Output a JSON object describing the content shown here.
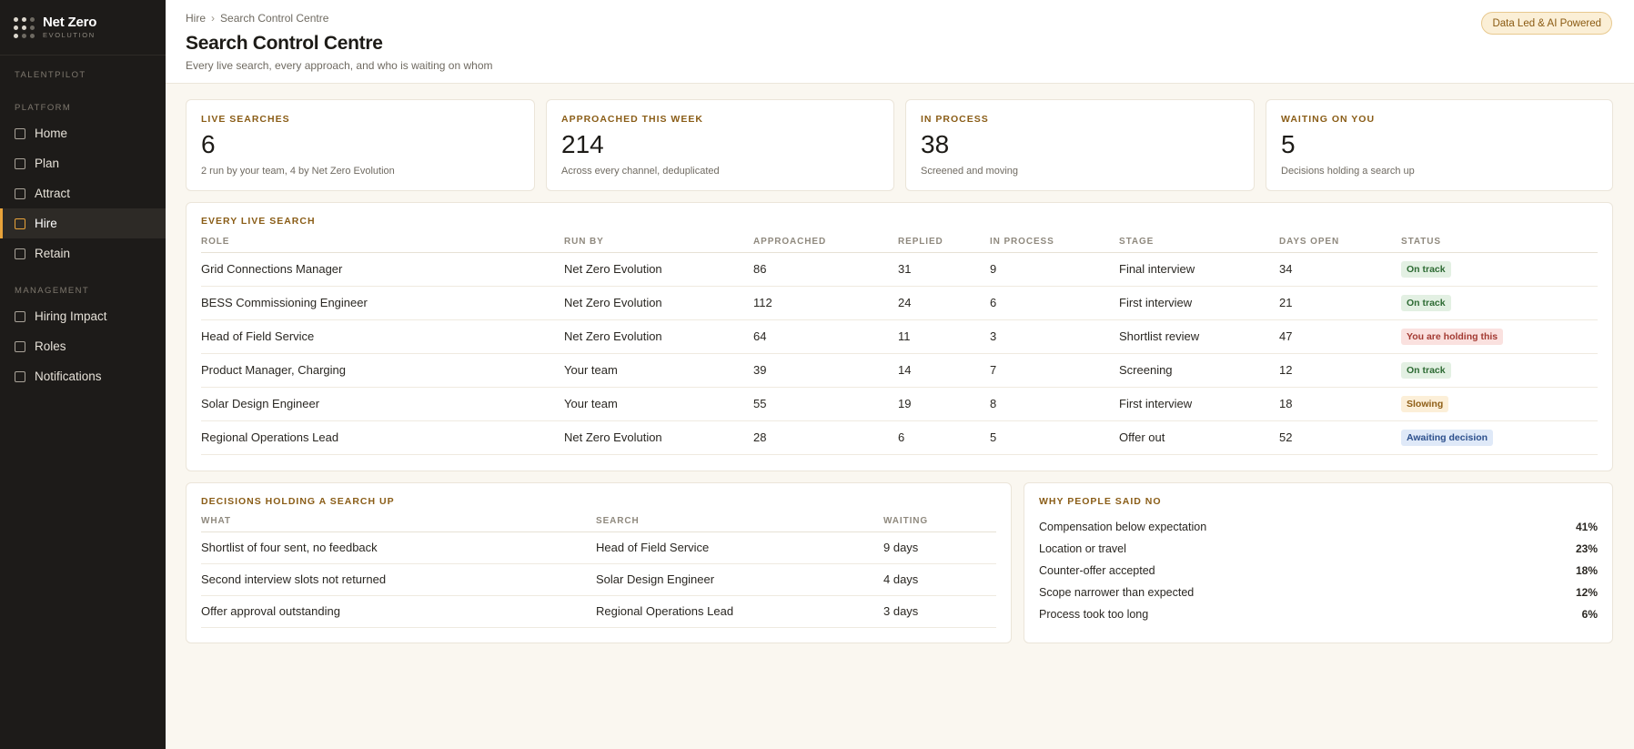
{
  "brand": {
    "name": "Net Zero",
    "sub": "EVOLUTION"
  },
  "sidebar": {
    "app_label": "TALENTPILOT",
    "platform_label": "PLATFORM",
    "platform_items": [
      {
        "label": "Home"
      },
      {
        "label": "Plan"
      },
      {
        "label": "Attract"
      },
      {
        "label": "Hire"
      },
      {
        "label": "Retain"
      }
    ],
    "management_label": "MANAGEMENT",
    "management_items": [
      {
        "label": "Hiring Impact"
      },
      {
        "label": "Roles"
      },
      {
        "label": "Notifications"
      }
    ],
    "active": "Hire"
  },
  "header": {
    "breadcrumb": [
      "Hire",
      "Search Control Centre"
    ],
    "breadcrumb_sep": "›",
    "title": "Search Control Centre",
    "subtitle": "Every live search, every approach, and who is waiting on whom",
    "badge": "Data Led & AI Powered"
  },
  "kpis": [
    {
      "label": "LIVE SEARCHES",
      "value": "6",
      "note": "2 run by your team, 4 by Net Zero Evolution"
    },
    {
      "label": "APPROACHED THIS WEEK",
      "value": "214",
      "note": "Across every channel, deduplicated"
    },
    {
      "label": "IN PROCESS",
      "value": "38",
      "note": "Screened and moving"
    },
    {
      "label": "WAITING ON YOU",
      "value": "5",
      "note": "Decisions holding a search up"
    }
  ],
  "searches": {
    "title": "EVERY LIVE SEARCH",
    "columns": [
      "ROLE",
      "RUN BY",
      "APPROACHED",
      "REPLIED",
      "IN PROCESS",
      "STAGE",
      "DAYS OPEN",
      "STATUS"
    ],
    "rows": [
      {
        "role": "Grid Connections Manager",
        "run_by": "Net Zero Evolution",
        "approached": "86",
        "replied": "31",
        "in_process": "9",
        "stage": "Final interview",
        "days_open": "34",
        "status": "On track",
        "status_kind": "green"
      },
      {
        "role": "BESS Commissioning Engineer",
        "run_by": "Net Zero Evolution",
        "approached": "112",
        "replied": "24",
        "in_process": "6",
        "stage": "First interview",
        "days_open": "21",
        "status": "On track",
        "status_kind": "green"
      },
      {
        "role": "Head of Field Service",
        "run_by": "Net Zero Evolution",
        "approached": "64",
        "replied": "11",
        "in_process": "3",
        "stage": "Shortlist review",
        "days_open": "47",
        "status": "You are holding this",
        "status_kind": "red"
      },
      {
        "role": "Product Manager, Charging",
        "run_by": "Your team",
        "approached": "39",
        "replied": "14",
        "in_process": "7",
        "stage": "Screening",
        "days_open": "12",
        "status": "On track",
        "status_kind": "green"
      },
      {
        "role": "Solar Design Engineer",
        "run_by": "Your team",
        "approached": "55",
        "replied": "19",
        "in_process": "8",
        "stage": "First interview",
        "days_open": "18",
        "status": "Slowing",
        "status_kind": "amber"
      },
      {
        "role": "Regional Operations Lead",
        "run_by": "Net Zero Evolution",
        "approached": "28",
        "replied": "6",
        "in_process": "5",
        "stage": "Offer out",
        "days_open": "52",
        "status": "Awaiting decision",
        "status_kind": "blue"
      }
    ]
  },
  "decisions": {
    "title": "DECISIONS HOLDING A SEARCH UP",
    "columns": [
      "WHAT",
      "SEARCH",
      "WAITING"
    ],
    "rows": [
      {
        "what": "Shortlist of four sent, no feedback",
        "search": "Head of Field Service",
        "waiting": "9 days"
      },
      {
        "what": "Second interview slots not returned",
        "search": "Solar Design Engineer",
        "waiting": "4 days"
      },
      {
        "what": "Offer approval outstanding",
        "search": "Regional Operations Lead",
        "waiting": "3 days"
      }
    ]
  },
  "reasons": {
    "title": "WHY PEOPLE SAID NO",
    "items": [
      {
        "label": "Compensation below expectation",
        "pct": "41%"
      },
      {
        "label": "Location or travel",
        "pct": "23%"
      },
      {
        "label": "Counter-offer accepted",
        "pct": "18%"
      },
      {
        "label": "Scope narrower than expected",
        "pct": "12%"
      },
      {
        "label": "Process took too long",
        "pct": "6%"
      }
    ]
  },
  "colors": {
    "sidebar_bg": "#1d1b19",
    "accent": "#e8a33a",
    "label_brown": "#8a5d17",
    "page_bg": "#faf7f0"
  }
}
